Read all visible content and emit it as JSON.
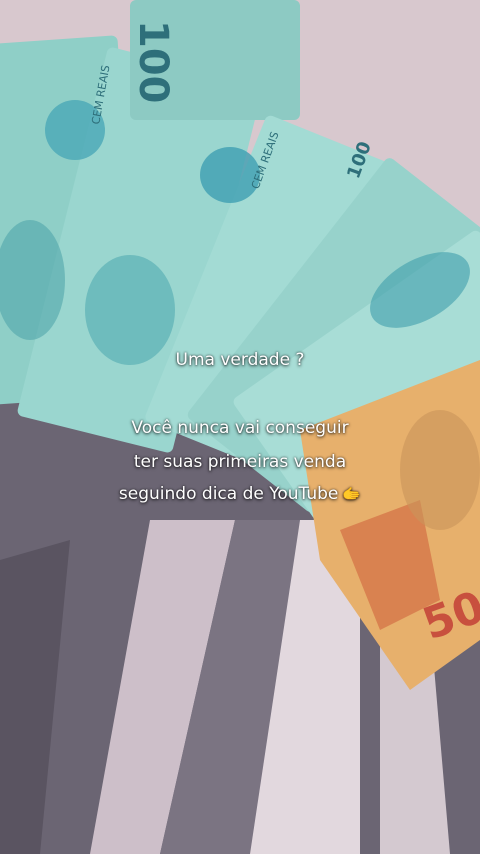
{
  "caption": {
    "line1": "Uma verdade  ?",
    "line2": "Você nunca vai conseguir",
    "line3": "ter suas primeiras venda",
    "line4": "seguindo dica de YouTube",
    "emoji": "🫱"
  },
  "banknotes": {
    "denomination_100": "100",
    "denomination_50": "50",
    "label_100": "CEM REAIS"
  },
  "colors": {
    "note_100": "#8fcfc7",
    "note_50": "#e7b06c",
    "stripe_dark": "#5b5563",
    "stripe_light": "#d9cfd6"
  }
}
